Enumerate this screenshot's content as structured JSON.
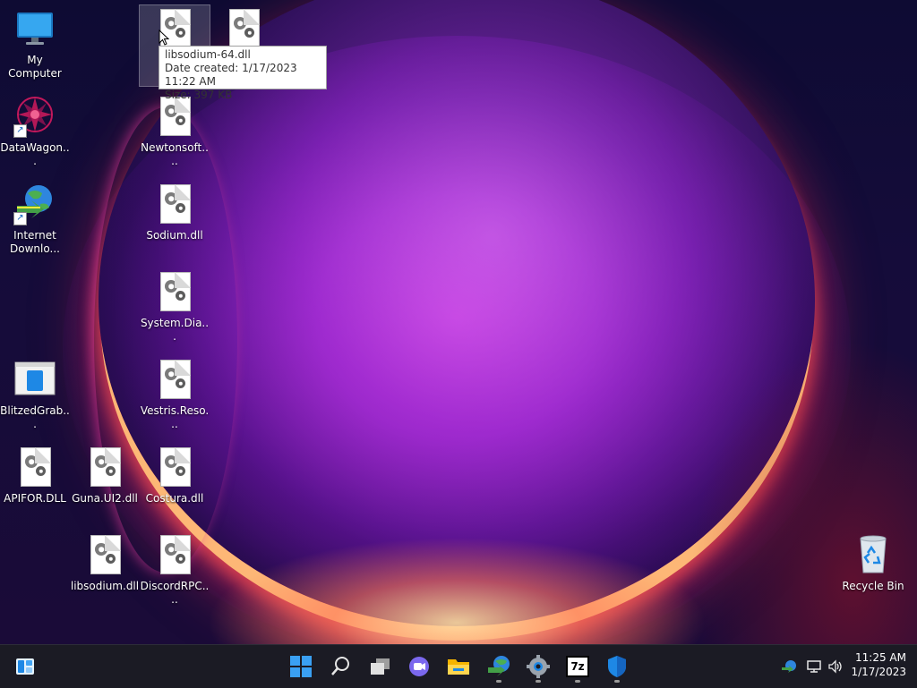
{
  "desktop": {
    "icons": [
      {
        "label": "My Computer"
      },
      {
        "label": "DataWagon..."
      },
      {
        "label": "Internet Downlo..."
      },
      {
        "label": "BlitzedGrab..."
      },
      {
        "label": "APIFOR.DLL"
      },
      {
        "label": "Guna.UI2.dll"
      },
      {
        "label": "libsodium.dll"
      },
      {
        "label": "libs"
      },
      {
        "label": ""
      },
      {
        "label": "Newtonsoft...."
      },
      {
        "label": "Sodium.dll"
      },
      {
        "label": "System.Dia..."
      },
      {
        "label": "Vestris.Reso..."
      },
      {
        "label": "Costura.dll"
      },
      {
        "label": "DiscordRPC...."
      },
      {
        "label": "Recycle Bin"
      }
    ]
  },
  "tooltip": {
    "name": "libsodium-64.dll",
    "date_created": "Date created: 1/17/2023 11:22 AM",
    "size": "Size: 397 KB"
  },
  "taskbar": {
    "pinned": [
      "widgets-icon",
      "start-icon",
      "search-icon",
      "task-view-icon",
      "chat-icon",
      "file-explorer-icon",
      "internet-download-manager-icon",
      "settings-icon",
      "7zip-icon",
      "windows-security-icon"
    ],
    "sevenzip_label": "7z",
    "time": "11:25 AM",
    "date": "1/17/2023"
  }
}
